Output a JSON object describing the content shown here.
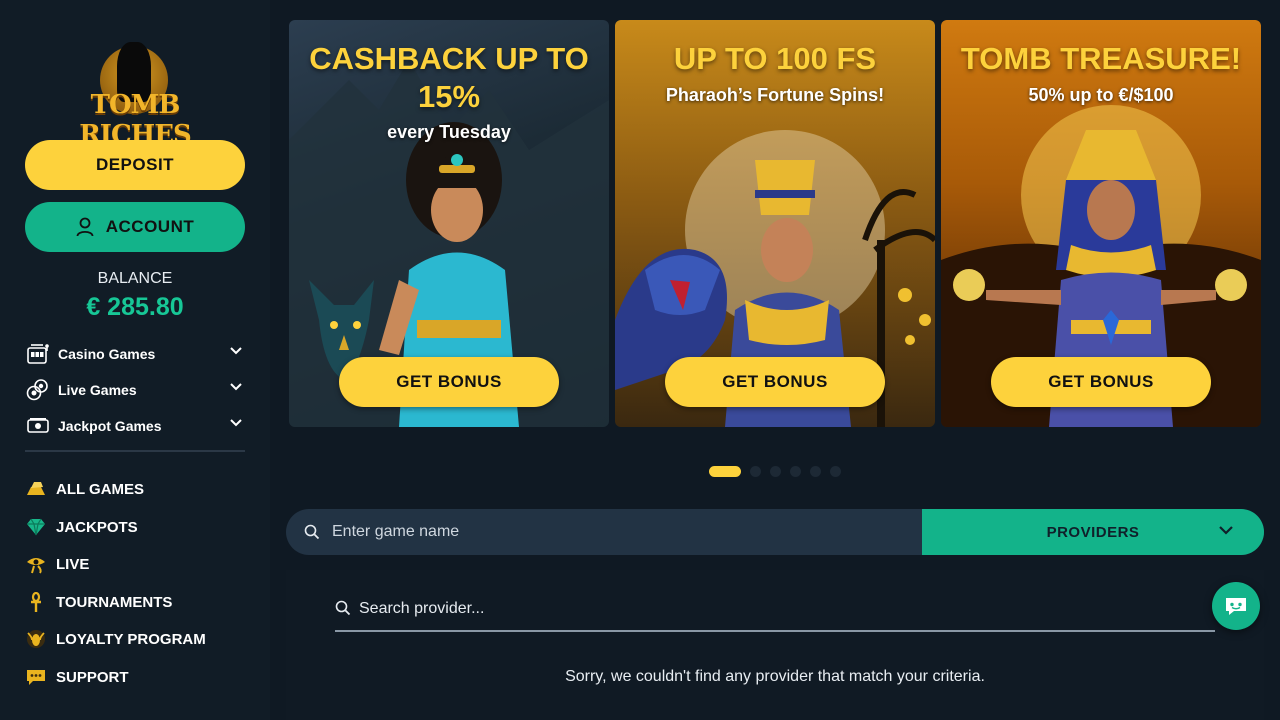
{
  "brand": {
    "logo_text": "TOMB RICHES"
  },
  "sidebar": {
    "deposit_label": "DEPOSIT",
    "account_label": "ACCOUNT",
    "balance_label": "BALANCE",
    "balance_value": "€ 285.80",
    "categories": [
      {
        "label": "Casino Games",
        "icon": "slot-machine-icon"
      },
      {
        "label": "Live Games",
        "icon": "chips-icon"
      },
      {
        "label": "Jackpot Games",
        "icon": "cash-icon"
      }
    ],
    "nav": [
      {
        "label": "ALL GAMES",
        "icon": "gold-bars-icon"
      },
      {
        "label": "JACKPOTS",
        "icon": "gem-icon"
      },
      {
        "label": "LIVE",
        "icon": "eye-of-horus-icon"
      },
      {
        "label": "TOURNAMENTS",
        "icon": "ankh-icon"
      },
      {
        "label": "LOYALTY PROGRAM",
        "icon": "scarab-icon"
      },
      {
        "label": "SUPPORT",
        "icon": "chat-bubble-icon"
      }
    ]
  },
  "banners": [
    {
      "title": "CASHBACK UP TO 15%",
      "subtitle": "every Tuesday",
      "button": "GET BONUS"
    },
    {
      "title": "UP TO 100 FS",
      "subtitle": "Pharaoh’s Fortune Spins!",
      "button": "GET BONUS"
    },
    {
      "title": "TOMB TREASURE!",
      "subtitle": "50% up to €/$100",
      "button": "GET BONUS"
    }
  ],
  "carousel": {
    "total_slides": 6,
    "active_slide": 1
  },
  "search": {
    "placeholder": "Enter game name",
    "providers_label": "PROVIDERS"
  },
  "provider_search": {
    "placeholder": "Search provider...",
    "no_results": "Sorry, we couldn't find any provider that match your criteria."
  },
  "colors": {
    "accent_yellow": "#fdd23c",
    "accent_green": "#13b38a",
    "balance_green": "#17c796",
    "background": "#0f1923",
    "sidebar": "#111c26"
  }
}
